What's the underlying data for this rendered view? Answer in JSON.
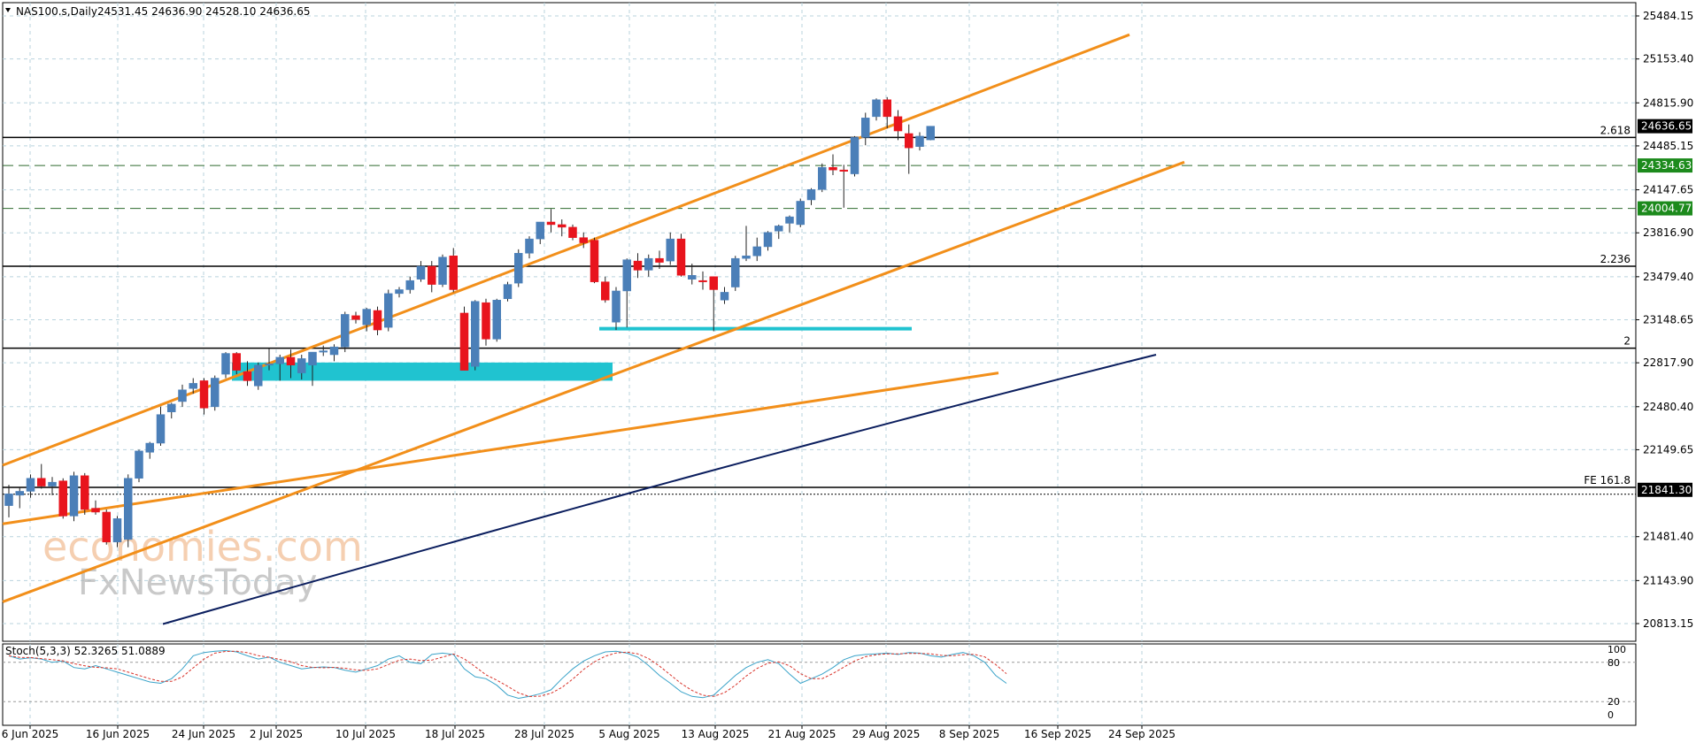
{
  "header": {
    "symbol": "NAS100.s,Daily",
    "ohlc": "24531.45 24636.90 24528.10 24636.65"
  },
  "watermark": {
    "line1": "economies.com",
    "line2": "FxNewsToday"
  },
  "chart_data": {
    "type": "candlestick",
    "colors": {
      "up": "#4b7fb8",
      "down": "#e8141d",
      "channel": "#f28f1a",
      "ma": "#0b1e5e",
      "zone": "#20c3d0",
      "grid": "#b9d3de",
      "level_green": "#1c8a1c"
    },
    "y_axis_ticks": [
      "25484.15",
      "25153.40",
      "24815.90",
      "24485.15",
      "24147.65",
      "23816.90",
      "23479.40",
      "23148.65",
      "22817.90",
      "22480.40",
      "22149.65",
      "21481.40",
      "21143.90",
      "20813.15"
    ],
    "x_axis_ticks": [
      "6 Jun 2025",
      "16 Jun 2025",
      "24 Jun 2025",
      "2 Jul 2025",
      "10 Jul 2025",
      "18 Jul 2025",
      "28 Jul 2025",
      "5 Aug 2025",
      "13 Aug 2025",
      "21 Aug 2025",
      "29 Aug 2025",
      "8 Sep 2025",
      "16 Sep 2025",
      "24 Sep 2025"
    ],
    "price_tags": [
      {
        "value": 24636.65,
        "text": "24636.65",
        "bg": "#000000",
        "fg": "#ffffff"
      },
      {
        "value": 24334.63,
        "text": "24334.63",
        "bg": "#1c8a1c",
        "fg": "#ffffff"
      },
      {
        "value": 24004.77,
        "text": "24004.77",
        "bg": "#1c8a1c",
        "fg": "#ffffff"
      },
      {
        "value": 21841.3,
        "text": "21841.30",
        "bg": "#000000",
        "fg": "#ffffff"
      }
    ],
    "horizontal_levels": [
      {
        "label": "2.618",
        "value": 24550
      },
      {
        "label": "2.236",
        "value": 23560
      },
      {
        "label": "2",
        "value": 22930
      },
      {
        "label": "FE 161.8",
        "value": 21860
      }
    ],
    "dashed_levels": [
      24334.63,
      24004.77
    ],
    "candles": [
      [
        21720,
        21880,
        21630,
        21810
      ],
      [
        21800,
        21860,
        21700,
        21830
      ],
      [
        21830,
        21960,
        21780,
        21930
      ],
      [
        21930,
        22040,
        21850,
        21870
      ],
      [
        21870,
        21940,
        21800,
        21900
      ],
      [
        21910,
        21930,
        21620,
        21640
      ],
      [
        21640,
        21980,
        21600,
        21950
      ],
      [
        21950,
        21970,
        21650,
        21690
      ],
      [
        21700,
        21760,
        21650,
        21670
      ],
      [
        21670,
        21690,
        21420,
        21440
      ],
      [
        21440,
        21640,
        21400,
        21620
      ],
      [
        21460,
        21960,
        21400,
        21930
      ],
      [
        21930,
        22150,
        21900,
        22140
      ],
      [
        22130,
        22210,
        22080,
        22200
      ],
      [
        22200,
        22480,
        22180,
        22420
      ],
      [
        22440,
        22510,
        22390,
        22500
      ],
      [
        22520,
        22650,
        22480,
        22610
      ],
      [
        22620,
        22700,
        22580,
        22660
      ],
      [
        22680,
        22700,
        22420,
        22470
      ],
      [
        22480,
        22720,
        22450,
        22700
      ],
      [
        22730,
        22900,
        22700,
        22890
      ],
      [
        22890,
        22900,
        22730,
        22760
      ],
      [
        22750,
        22830,
        22640,
        22680
      ],
      [
        22640,
        22820,
        22610,
        22800
      ],
      [
        22800,
        22930,
        22760,
        22810
      ],
      [
        22810,
        22880,
        22680,
        22860
      ],
      [
        22860,
        22920,
        22700,
        22800
      ],
      [
        22740,
        22880,
        22690,
        22850
      ],
      [
        22800,
        22900,
        22640,
        22900
      ],
      [
        22900,
        22950,
        22870,
        22910
      ],
      [
        22880,
        22960,
        22830,
        22940
      ],
      [
        22940,
        23210,
        22900,
        23190
      ],
      [
        23180,
        23210,
        23120,
        23150
      ],
      [
        23110,
        23240,
        23060,
        23230
      ],
      [
        23220,
        23250,
        23030,
        23070
      ],
      [
        23090,
        23380,
        23060,
        23350
      ],
      [
        23350,
        23400,
        23320,
        23380
      ],
      [
        23380,
        23480,
        23350,
        23450
      ],
      [
        23460,
        23600,
        23440,
        23560
      ],
      [
        23560,
        23600,
        23360,
        23420
      ],
      [
        23420,
        23650,
        23400,
        23630
      ],
      [
        23640,
        23700,
        23360,
        23380
      ],
      [
        23200,
        23250,
        22760,
        22760
      ],
      [
        22790,
        23300,
        22760,
        23290
      ],
      [
        23280,
        23310,
        22950,
        23000
      ],
      [
        23000,
        23310,
        22980,
        23300
      ],
      [
        23310,
        23440,
        23290,
        23420
      ],
      [
        23430,
        23690,
        23400,
        23660
      ],
      [
        23660,
        23790,
        23620,
        23770
      ],
      [
        23770,
        23900,
        23730,
        23900
      ],
      [
        23900,
        24000,
        23820,
        23880
      ],
      [
        23880,
        23920,
        23790,
        23860
      ],
      [
        23860,
        23880,
        23760,
        23780
      ],
      [
        23780,
        23820,
        23700,
        23740
      ],
      [
        23760,
        23780,
        23430,
        23440
      ],
      [
        23440,
        23480,
        23280,
        23300
      ],
      [
        23130,
        23400,
        23070,
        23370
      ],
      [
        23370,
        23620,
        23090,
        23610
      ],
      [
        23600,
        23660,
        23470,
        23530
      ],
      [
        23530,
        23650,
        23480,
        23620
      ],
      [
        23620,
        23680,
        23540,
        23590
      ],
      [
        23600,
        23820,
        23570,
        23770
      ],
      [
        23770,
        23810,
        23480,
        23490
      ],
      [
        23460,
        23580,
        23420,
        23490
      ],
      [
        23450,
        23520,
        23380,
        23440
      ],
      [
        23480,
        23480,
        23060,
        23380
      ],
      [
        23300,
        23400,
        23270,
        23360
      ],
      [
        23400,
        23640,
        23370,
        23620
      ],
      [
        23620,
        23870,
        23600,
        23640
      ],
      [
        23640,
        23780,
        23600,
        23710
      ],
      [
        23710,
        23830,
        23680,
        23820
      ],
      [
        23830,
        23880,
        23770,
        23870
      ],
      [
        23890,
        23950,
        23820,
        23940
      ],
      [
        23880,
        24080,
        23860,
        24060
      ],
      [
        24070,
        24160,
        24030,
        24150
      ],
      [
        24150,
        24350,
        24130,
        24320
      ],
      [
        24320,
        24420,
        24260,
        24300
      ],
      [
        24300,
        24340,
        24010,
        24290
      ],
      [
        24270,
        24560,
        24250,
        24550
      ],
      [
        24550,
        24740,
        24490,
        24700
      ],
      [
        24710,
        24850,
        24680,
        24840
      ],
      [
        24840,
        24860,
        24620,
        24710
      ],
      [
        24710,
        24760,
        24530,
        24600
      ],
      [
        24580,
        24650,
        24270,
        24470
      ],
      [
        24480,
        24590,
        24450,
        24560
      ],
      [
        24531.45,
        24636.9,
        24528.1,
        24636.65
      ]
    ],
    "moving_average_endpoints": [
      20810,
      22880
    ],
    "stochastic": {
      "label": "Stoch(5,3,3) 52.3265 51.0889",
      "k_main": 52.3265,
      "d_signal": 51.0889,
      "levels": [
        100,
        80,
        20,
        0
      ],
      "level_labels": [
        "100",
        "80",
        "20",
        "0"
      ],
      "k": [
        90,
        85,
        87,
        85,
        80,
        82,
        72,
        70,
        75,
        70,
        65,
        60,
        55,
        50,
        48,
        55,
        70,
        90,
        95,
        97,
        98,
        96,
        90,
        85,
        88,
        80,
        75,
        70,
        72,
        73,
        72,
        68,
        65,
        70,
        75,
        85,
        90,
        80,
        78,
        92,
        94,
        92,
        70,
        58,
        55,
        45,
        30,
        25,
        28,
        32,
        38,
        55,
        70,
        82,
        90,
        96,
        97,
        94,
        88,
        75,
        60,
        48,
        35,
        28,
        26,
        30,
        45,
        60,
        72,
        80,
        84,
        78,
        62,
        48,
        55,
        62,
        72,
        84,
        90,
        92,
        93,
        94,
        92,
        95,
        94,
        90,
        88,
        92,
        95,
        90,
        80,
        60,
        48
      ]
    }
  }
}
